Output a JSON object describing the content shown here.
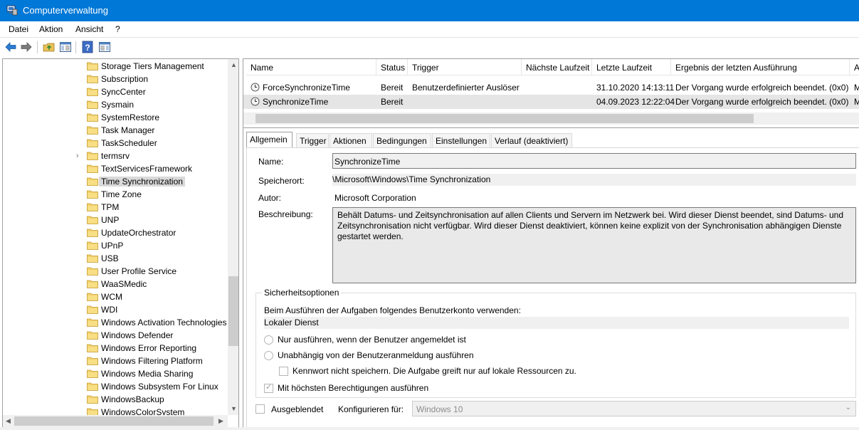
{
  "window": {
    "title": "Computerverwaltung"
  },
  "menu": [
    "Datei",
    "Aktion",
    "Ansicht",
    "?"
  ],
  "toolbar": {
    "icons": [
      "back-icon",
      "forward-icon",
      "up-folder-icon",
      "show-hide-tree-icon",
      "help-icon",
      "show-hide-action-pane-icon"
    ]
  },
  "tree": {
    "items": [
      {
        "label": "Storage Tiers Management",
        "expandable": false
      },
      {
        "label": "Subscription",
        "expandable": false
      },
      {
        "label": "SyncCenter",
        "expandable": false
      },
      {
        "label": "Sysmain",
        "expandable": false
      },
      {
        "label": "SystemRestore",
        "expandable": false
      },
      {
        "label": "Task Manager",
        "expandable": false
      },
      {
        "label": "TaskScheduler",
        "expandable": false
      },
      {
        "label": "termsrv",
        "expandable": true
      },
      {
        "label": "TextServicesFramework",
        "expandable": false
      },
      {
        "label": "Time Synchronization",
        "expandable": false,
        "selected": true
      },
      {
        "label": "Time Zone",
        "expandable": false
      },
      {
        "label": "TPM",
        "expandable": false
      },
      {
        "label": "UNP",
        "expandable": false
      },
      {
        "label": "UpdateOrchestrator",
        "expandable": false
      },
      {
        "label": "UPnP",
        "expandable": false
      },
      {
        "label": "USB",
        "expandable": false
      },
      {
        "label": "User Profile Service",
        "expandable": false
      },
      {
        "label": "WaaSMedic",
        "expandable": false
      },
      {
        "label": "WCM",
        "expandable": false
      },
      {
        "label": "WDI",
        "expandable": false
      },
      {
        "label": "Windows Activation Technologies",
        "expandable": false
      },
      {
        "label": "Windows Defender",
        "expandable": false
      },
      {
        "label": "Windows Error Reporting",
        "expandable": false
      },
      {
        "label": "Windows Filtering Platform",
        "expandable": false
      },
      {
        "label": "Windows Media Sharing",
        "expandable": false
      },
      {
        "label": "Windows Subsystem For Linux",
        "expandable": false
      },
      {
        "label": "WindowsBackup",
        "expandable": false
      },
      {
        "label": "WindowsColorSystem",
        "expandable": false
      }
    ]
  },
  "task_list": {
    "columns": [
      "Name",
      "Status",
      "Trigger",
      "Nächste Laufzeit",
      "Letzte Laufzeit",
      "Ergebnis der letzten Ausführung",
      "A"
    ],
    "rows": [
      {
        "name": "ForceSynchronizeTime",
        "status": "Bereit",
        "trigger": "Benutzerdefinierter Auslöser",
        "next_run": "",
        "last_run": "31.10.2020 14:13:11",
        "result": "Der Vorgang wurde erfolgreich beendet. (0x0)",
        "author": "M"
      },
      {
        "name": "SynchronizeTime",
        "status": "Bereit",
        "trigger": "",
        "next_run": "",
        "last_run": "04.09.2023 12:22:04",
        "result": "Der Vorgang wurde erfolgreich beendet. (0x0)",
        "author": "M",
        "selected": true
      }
    ]
  },
  "tabs": [
    "Allgemein",
    "Trigger",
    "Aktionen",
    "Bedingungen",
    "Einstellungen",
    "Verlauf (deaktiviert)"
  ],
  "general": {
    "name_label": "Name:",
    "name_value": "SynchronizeTime",
    "location_label": "Speicherort:",
    "location_value": "\\Microsoft\\Windows\\Time Synchronization",
    "author_label": "Autor:",
    "author_value": "Microsoft Corporation",
    "description_label": "Beschreibung:",
    "description_value": "Behält Datums- und Zeitsynchronisation auf allen Clients und Servern im Netzwerk bei. Wird dieser Dienst beendet, sind Datums- und Zeitsynchronisation nicht verfügbar. Wird dieser Dienst deaktiviert, können keine explizit von der Synchronisation abhängigen Dienste gestartet werden."
  },
  "security": {
    "title": "Sicherheitsoptionen",
    "account_prompt": "Beim Ausführen der Aufgaben folgendes Benutzerkonto verwenden:",
    "account_value": "Lokaler Dienst",
    "option_logged_on": "Nur ausführen, wenn der Benutzer angemeldet ist",
    "option_independent": "Unabhängig von der Benutzeranmeldung ausführen",
    "option_no_password": "Kennwort nicht speichern. Die Aufgabe greift nur auf lokale Ressourcen zu.",
    "option_highest": "Mit höchsten Berechtigungen ausführen",
    "highest_checked": true
  },
  "footer": {
    "hidden_label": "Ausgeblendet",
    "configure_label": "Konfigurieren für:",
    "configure_value": "Windows 10"
  }
}
